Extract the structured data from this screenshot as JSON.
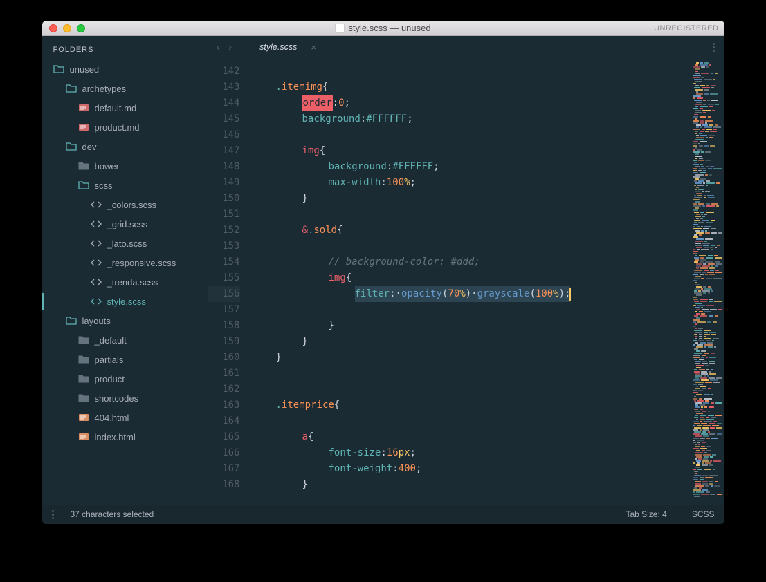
{
  "window": {
    "title": "style.scss — unused",
    "unregistered": "UNREGISTERED"
  },
  "sidebar": {
    "header": "FOLDERS",
    "tree": [
      {
        "depth": 0,
        "type": "folder-open",
        "label": "unused"
      },
      {
        "depth": 1,
        "type": "folder-open",
        "label": "archetypes"
      },
      {
        "depth": 2,
        "type": "md",
        "label": "default.md"
      },
      {
        "depth": 2,
        "type": "md",
        "label": "product.md"
      },
      {
        "depth": 1,
        "type": "folder-open",
        "label": "dev"
      },
      {
        "depth": 2,
        "type": "folder-closed",
        "label": "bower"
      },
      {
        "depth": 2,
        "type": "folder-open",
        "label": "scss"
      },
      {
        "depth": 3,
        "type": "code",
        "label": "_colors.scss"
      },
      {
        "depth": 3,
        "type": "code",
        "label": "_grid.scss"
      },
      {
        "depth": 3,
        "type": "code",
        "label": "_lato.scss"
      },
      {
        "depth": 3,
        "type": "code",
        "label": "_responsive.scss"
      },
      {
        "depth": 3,
        "type": "code",
        "label": "_trenda.scss"
      },
      {
        "depth": 3,
        "type": "code",
        "label": "style.scss",
        "active": true
      },
      {
        "depth": 1,
        "type": "folder-open",
        "label": "layouts"
      },
      {
        "depth": 2,
        "type": "folder-closed",
        "label": "_default"
      },
      {
        "depth": 2,
        "type": "folder-closed",
        "label": "partials"
      },
      {
        "depth": 2,
        "type": "folder-closed",
        "label": "product"
      },
      {
        "depth": 2,
        "type": "folder-closed",
        "label": "shortcodes"
      },
      {
        "depth": 2,
        "type": "html",
        "label": "404.html"
      },
      {
        "depth": 2,
        "type": "html",
        "label": "index.html"
      }
    ]
  },
  "tabs": {
    "active": "style.scss"
  },
  "editor": {
    "first_line": 142,
    "highlighted_line": 156,
    "lines": [
      {
        "n": 142,
        "seg": []
      },
      {
        "n": 143,
        "seg": [
          [
            "pad1"
          ],
          [
            "c-sel-dot",
            "."
          ],
          [
            "c-sel",
            "itemimg"
          ],
          [
            "sp",
            " "
          ],
          [
            "c-brace",
            "{"
          ]
        ]
      },
      {
        "n": 144,
        "seg": [
          [
            "pad2"
          ],
          [
            "highlight-find",
            "order"
          ],
          [
            "c-punc",
            ":"
          ],
          [
            "sp",
            " "
          ],
          [
            "c-num",
            "0"
          ],
          [
            "c-punc",
            ";"
          ]
        ]
      },
      {
        "n": 145,
        "seg": [
          [
            "pad2"
          ],
          [
            "c-prop",
            "background"
          ],
          [
            "c-punc",
            ":"
          ],
          [
            "sp",
            " "
          ],
          [
            "c-hex",
            "#FFFFFF"
          ],
          [
            "c-punc",
            ";"
          ]
        ]
      },
      {
        "n": 146,
        "seg": []
      },
      {
        "n": 147,
        "seg": [
          [
            "pad2"
          ],
          [
            "c-tag",
            "img"
          ],
          [
            "sp",
            " "
          ],
          [
            "c-brace",
            "{"
          ]
        ]
      },
      {
        "n": 148,
        "seg": [
          [
            "pad3"
          ],
          [
            "c-prop",
            "background"
          ],
          [
            "c-punc",
            ":"
          ],
          [
            "sp",
            " "
          ],
          [
            "c-hex",
            "#FFFFFF"
          ],
          [
            "c-punc",
            ";"
          ]
        ]
      },
      {
        "n": 149,
        "seg": [
          [
            "pad3"
          ],
          [
            "c-prop",
            "max-width"
          ],
          [
            "c-punc",
            ":"
          ],
          [
            "sp",
            " "
          ],
          [
            "c-num",
            "100"
          ],
          [
            "c-kw",
            "%"
          ],
          [
            "c-punc",
            ";"
          ]
        ]
      },
      {
        "n": 150,
        "seg": [
          [
            "pad2"
          ],
          [
            "c-brace",
            "}"
          ]
        ]
      },
      {
        "n": 151,
        "seg": []
      },
      {
        "n": 152,
        "seg": [
          [
            "pad2"
          ],
          [
            "c-amp",
            "&"
          ],
          [
            "c-sel-dot",
            "."
          ],
          [
            "c-sel",
            "sold"
          ],
          [
            "sp",
            " "
          ],
          [
            "c-brace",
            "{"
          ]
        ]
      },
      {
        "n": 153,
        "seg": []
      },
      {
        "n": 154,
        "seg": [
          [
            "pad3"
          ],
          [
            "c-comment",
            "// background-color: #ddd;"
          ]
        ]
      },
      {
        "n": 155,
        "seg": [
          [
            "pad3"
          ],
          [
            "c-tag",
            "img"
          ],
          [
            "sp",
            " "
          ],
          [
            "c-brace",
            "{"
          ]
        ]
      },
      {
        "n": 156,
        "seg": [
          [
            "pad4"
          ],
          [
            "sel-start"
          ],
          [
            "c-prop",
            "filter"
          ],
          [
            "c-punc",
            ":"
          ],
          [
            "c-punc",
            "·"
          ],
          [
            "c-func",
            "opacity"
          ],
          [
            "c-punc",
            "("
          ],
          [
            "c-num",
            "70"
          ],
          [
            "c-kw",
            "%"
          ],
          [
            "c-punc",
            ")"
          ],
          [
            "c-punc",
            "·"
          ],
          [
            "c-func",
            "grayscale"
          ],
          [
            "c-punc",
            "("
          ],
          [
            "c-num",
            "100"
          ],
          [
            "c-kw",
            "%"
          ],
          [
            "c-punc",
            ")"
          ],
          [
            "c-punc",
            ";"
          ],
          [
            "sel-end"
          ],
          [
            "cursor"
          ]
        ]
      },
      {
        "n": 157,
        "seg": []
      },
      {
        "n": 158,
        "seg": [
          [
            "pad3"
          ],
          [
            "c-brace",
            "}"
          ]
        ]
      },
      {
        "n": 159,
        "seg": [
          [
            "pad2"
          ],
          [
            "c-brace",
            "}"
          ]
        ]
      },
      {
        "n": 160,
        "seg": [
          [
            "pad1"
          ],
          [
            "c-brace",
            "}"
          ]
        ]
      },
      {
        "n": 161,
        "seg": []
      },
      {
        "n": 162,
        "seg": []
      },
      {
        "n": 163,
        "seg": [
          [
            "pad1"
          ],
          [
            "c-sel-dot",
            "."
          ],
          [
            "c-sel",
            "itemprice"
          ],
          [
            "sp",
            " "
          ],
          [
            "c-brace",
            "{"
          ]
        ]
      },
      {
        "n": 164,
        "seg": []
      },
      {
        "n": 165,
        "seg": [
          [
            "pad2"
          ],
          [
            "c-tag",
            "a"
          ],
          [
            "sp",
            " "
          ],
          [
            "c-brace",
            "{"
          ]
        ]
      },
      {
        "n": 166,
        "seg": [
          [
            "pad3"
          ],
          [
            "c-prop",
            "font-size"
          ],
          [
            "c-punc",
            ":"
          ],
          [
            "sp",
            " "
          ],
          [
            "c-num",
            "16"
          ],
          [
            "c-kw",
            "px"
          ],
          [
            "c-punc",
            ";"
          ]
        ]
      },
      {
        "n": 167,
        "seg": [
          [
            "pad3"
          ],
          [
            "c-prop",
            "font-weight"
          ],
          [
            "c-punc",
            ":"
          ],
          [
            "sp",
            " "
          ],
          [
            "c-num",
            "400"
          ],
          [
            "c-punc",
            ";"
          ]
        ]
      },
      {
        "n": 168,
        "seg": [
          [
            "pad2"
          ],
          [
            "c-brace",
            "}"
          ]
        ]
      }
    ]
  },
  "status": {
    "left": "37 characters selected",
    "tab_size": "Tab Size: 4",
    "lang": "SCSS"
  },
  "colors": {
    "bg": "#1b2b34",
    "accent": "#5fb3b3"
  }
}
